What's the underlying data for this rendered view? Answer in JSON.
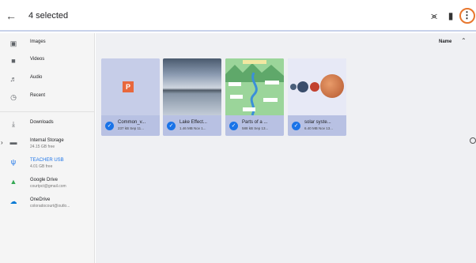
{
  "topbar": {
    "back_icon": "arrow-left-icon",
    "title": "4 selected",
    "share_icon": "share-icon",
    "delete_icon": "trash-icon",
    "more_icon": "more-vert-icon",
    "highlight_color": "#e8772e"
  },
  "sidebar": {
    "items": [
      {
        "label": "Images",
        "icon": "image-icon"
      },
      {
        "label": "Videos",
        "icon": "video-icon"
      },
      {
        "label": "Audio",
        "icon": "audio-icon"
      },
      {
        "label": "Recent",
        "icon": "clock-icon"
      },
      {
        "label": "Downloads",
        "icon": "download-icon"
      },
      {
        "label": "Internal Storage",
        "sub": "24.15 GB free",
        "icon": "storage-icon"
      },
      {
        "label": "TEACHER USB",
        "sub": "4.01 GB free",
        "icon": "usb-icon"
      },
      {
        "label": "Google Drive",
        "sub": "courtpct@gmail.com",
        "icon": "google-drive-icon"
      },
      {
        "label": "OneDrive",
        "sub": "coloradocourt@outlo...",
        "icon": "onedrive-icon"
      }
    ]
  },
  "main": {
    "sort_label": "Name",
    "sort_icon": "chevron-up-icon",
    "files": [
      {
        "name": "Common_v...",
        "meta": "237 kB Sep 11...",
        "selected": true
      },
      {
        "name": "Lake Effect...",
        "meta": "1.46 MB Nov 1...",
        "selected": true
      },
      {
        "name": "Parts of a ...",
        "meta": "588 kB Sep 13...",
        "selected": true
      },
      {
        "name": "solar syste...",
        "meta": "6.40 MB Nov 13...",
        "selected": true
      }
    ]
  },
  "colors": {
    "selection_tile": "#c6cde8",
    "check": "#1a73e8",
    "sidebar_bg": "#f5f5f5"
  }
}
